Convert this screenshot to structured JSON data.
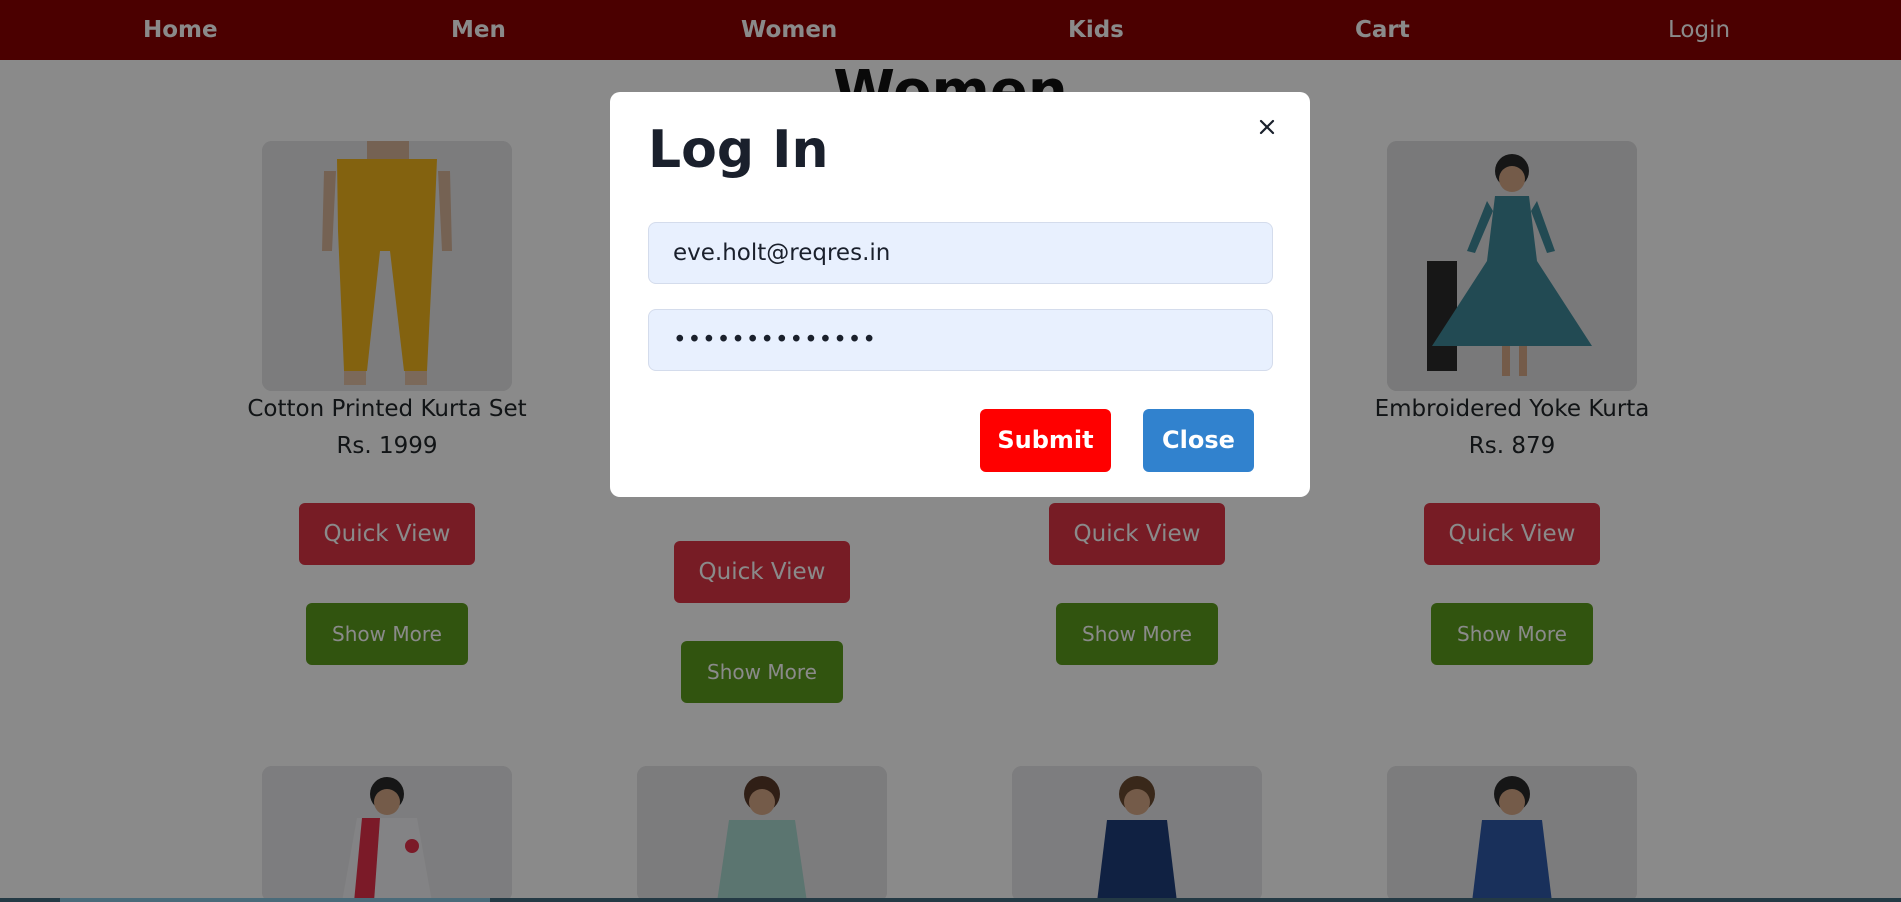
{
  "nav": {
    "home": "Home",
    "men": "Men",
    "women": "Women",
    "kids": "Kids",
    "cart": "Cart",
    "login": "Login"
  },
  "page_title": "Women",
  "products_row1": [
    {
      "name": "Cotton Printed Kurta Set",
      "price": "Rs. 1999",
      "quick_view": "Quick View",
      "show_more": "Show More",
      "image": "yellow-pants-model"
    },
    {
      "name": "",
      "price": "",
      "quick_view": "Quick View",
      "show_more": "Show More",
      "image": "hidden-product"
    },
    {
      "name": "",
      "price": "",
      "quick_view": "Quick View",
      "show_more": "Show More",
      "image": "hidden-product"
    },
    {
      "name": "Embroidered Yoke Kurta",
      "price": "Rs. 879",
      "quick_view": "Quick View",
      "show_more": "Show More",
      "image": "teal-dress-model"
    }
  ],
  "products_row2": [
    {
      "image": "white-red-kurta-model"
    },
    {
      "image": "mint-kurta-model"
    },
    {
      "image": "navy-kurta-model"
    },
    {
      "image": "blue-kurta-model"
    }
  ],
  "login_modal": {
    "title": "Log In",
    "email_value": "eve.holt@reqres.in",
    "password_value": "••••••••••••••",
    "submit_label": "Submit",
    "close_label": "Close",
    "close_icon": "close-icon"
  },
  "colors": {
    "navbar": "#8b0000",
    "quick_view": "#dc3545",
    "show_more": "#5c9c1c",
    "submit": "#ff0000",
    "close": "#3182ce"
  }
}
